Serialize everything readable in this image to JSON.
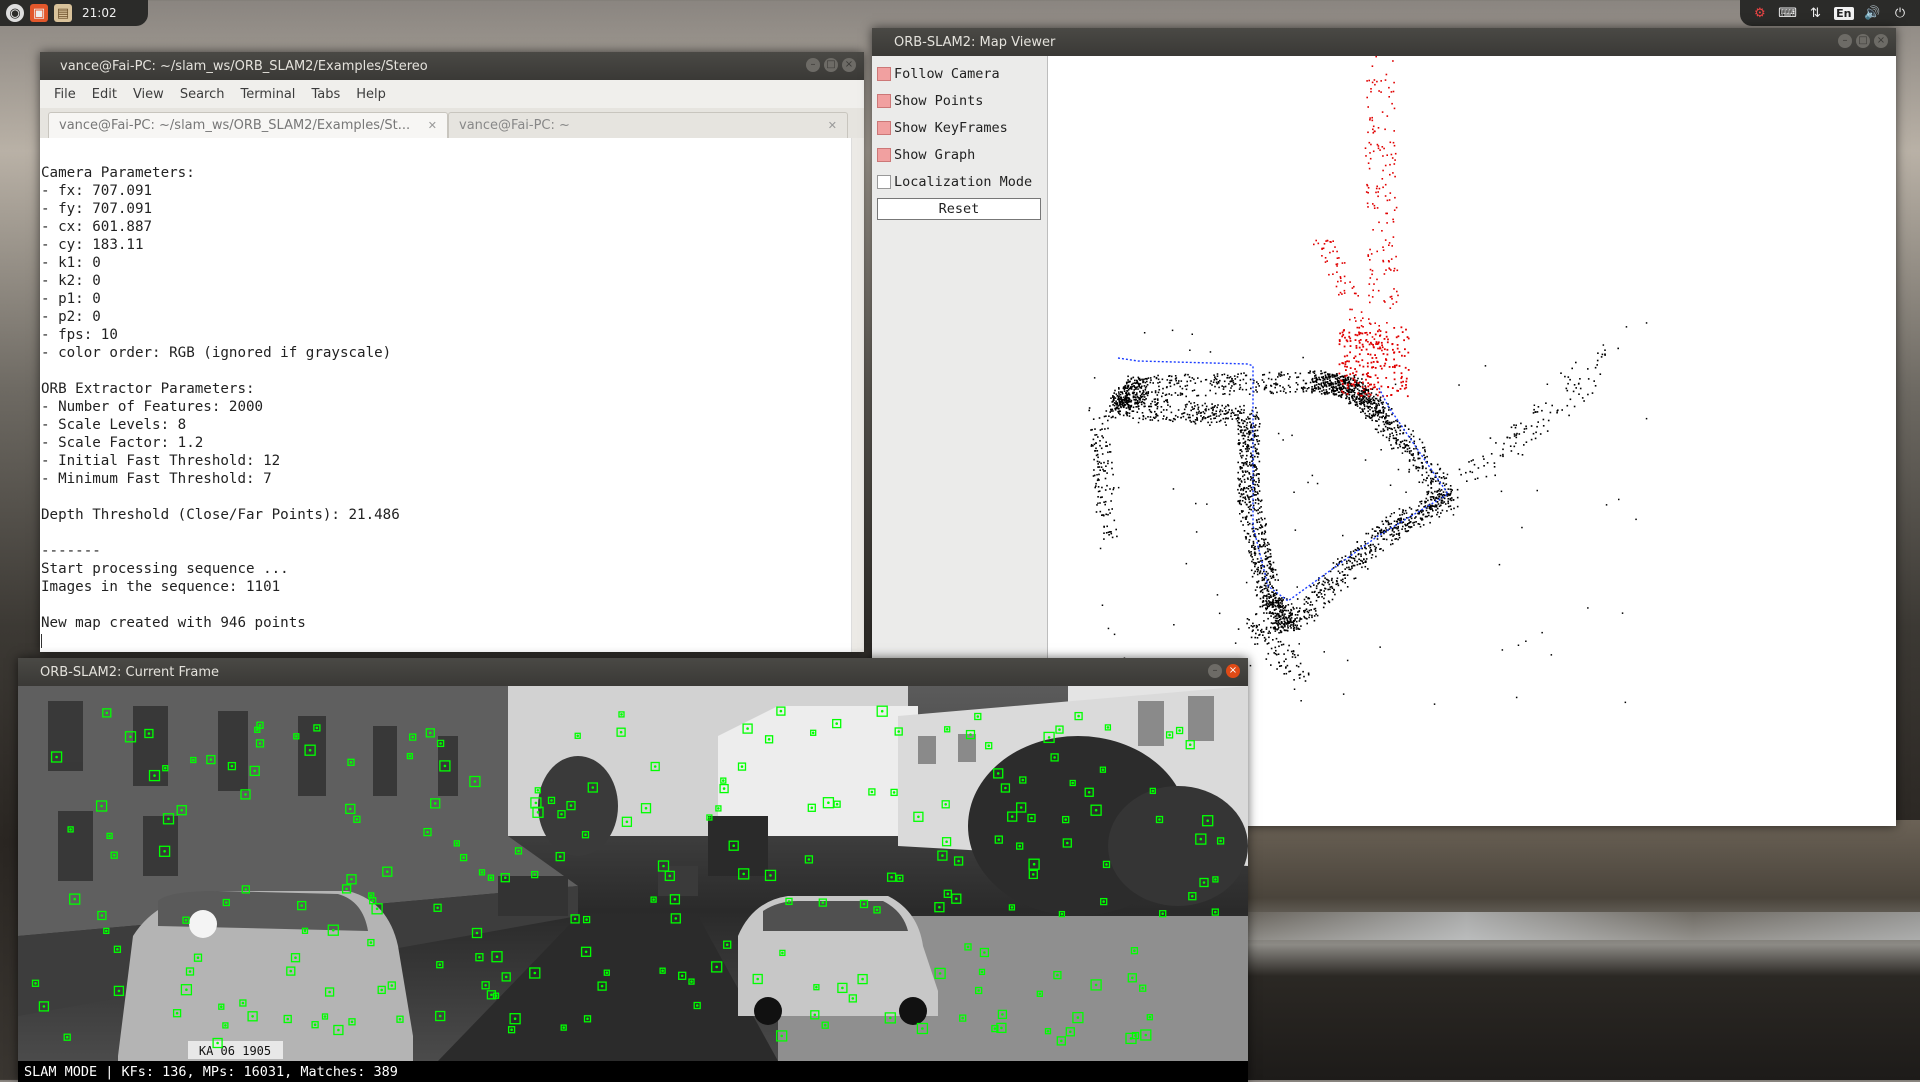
{
  "top_panel": {
    "clock": "21:02",
    "language": "En"
  },
  "terminal": {
    "title": "vance@Fai-PC: ~/slam_ws/ORB_SLAM2/Examples/Stereo",
    "menu": [
      "File",
      "Edit",
      "View",
      "Search",
      "Terminal",
      "Tabs",
      "Help"
    ],
    "tabs": [
      {
        "label": "vance@Fai-PC: ~/slam_ws/ORB_SLAM2/Examples/St...",
        "active": true
      },
      {
        "label": "vance@Fai-PC: ~",
        "active": false
      }
    ],
    "lines": [
      "",
      "Camera Parameters:",
      "- fx: 707.091",
      "- fy: 707.091",
      "- cx: 601.887",
      "- cy: 183.11",
      "- k1: 0",
      "- k2: 0",
      "- p1: 0",
      "- p2: 0",
      "- fps: 10",
      "- color order: RGB (ignored if grayscale)",
      "",
      "ORB Extractor Parameters:",
      "- Number of Features: 2000",
      "- Scale Levels: 8",
      "- Scale Factor: 1.2",
      "- Initial Fast Threshold: 12",
      "- Minimum Fast Threshold: 7",
      "",
      "Depth Threshold (Close/Far Points): 21.486",
      "",
      "-------",
      "Start processing sequence ...",
      "Images in the sequence: 1101",
      "",
      "New map created with 946 points"
    ]
  },
  "map_viewer": {
    "title": "ORB-SLAM2: Map Viewer",
    "options": [
      {
        "label": "Follow Camera",
        "checked": true
      },
      {
        "label": "Show Points",
        "checked": true
      },
      {
        "label": "Show KeyFrames",
        "checked": true
      },
      {
        "label": "Show Graph",
        "checked": true
      },
      {
        "label": "Localization Mode",
        "checked": false
      }
    ],
    "reset_label": "Reset",
    "colors": {
      "map_points": "#000000",
      "local_points": "#e00000",
      "trajectory": "#1a3cff"
    }
  },
  "current_frame": {
    "title": "ORB-SLAM2: Current Frame",
    "status": "SLAM MODE |  KFs: 136, MPs: 16031, Matches: 389",
    "plate": "KA 06 1905",
    "feature_color": "#00ff00"
  }
}
